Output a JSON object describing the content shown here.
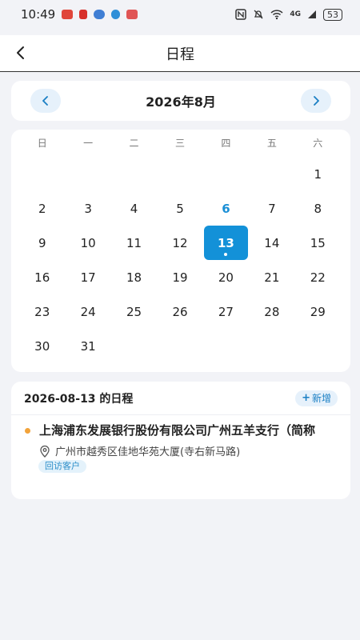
{
  "status_bar": {
    "time": "10:49",
    "network": "4G",
    "battery": "53",
    "notif_colors": [
      "#e0463b",
      "#d8302a",
      "#3f7ed4",
      "#2f8fd8",
      "#e05555"
    ]
  },
  "header": {
    "title": "日程",
    "back_icon": "chevron-left-icon"
  },
  "month_nav": {
    "label": "2026年8月",
    "prev_icon": "chevron-left-icon",
    "next_icon": "chevron-right-icon"
  },
  "calendar": {
    "weekdays": [
      "日",
      "一",
      "二",
      "三",
      "四",
      "五",
      "六"
    ],
    "leading_empty": 6,
    "days": [
      "1",
      "2",
      "3",
      "4",
      "5",
      "6",
      "7",
      "8",
      "9",
      "10",
      "11",
      "12",
      "13",
      "14",
      "15",
      "16",
      "17",
      "18",
      "19",
      "20",
      "21",
      "22",
      "23",
      "24",
      "25",
      "26",
      "27",
      "28",
      "29",
      "30",
      "31"
    ],
    "today": "6",
    "selected": "13",
    "accent": "#1391d8"
  },
  "schedule": {
    "title": "2026-08-13 的日程",
    "add_label": "新增",
    "add_icon": "plus-icon",
    "events": [
      {
        "name": "上海浦东发展银行股份有限公司广州五羊支行（简称",
        "location": "广州市越秀区佳地华苑大厦(寺右新马路)",
        "tag": "回访客户",
        "bullet_color": "#f2a33a"
      }
    ]
  }
}
